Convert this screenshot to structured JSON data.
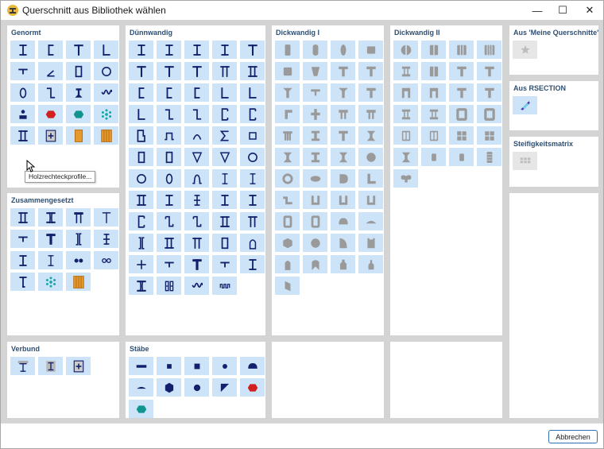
{
  "window": {
    "title": "Querschnitt aus Bibliothek wählen",
    "minimize_glyph": "—",
    "maximize_glyph": "☐",
    "close_glyph": "✕"
  },
  "colors": {
    "tile_fill": "#cde3f7",
    "shape_fill": "#14206b",
    "shape_gray": "#9a9a9a",
    "heading_text": "#2e4f73",
    "panel_bg": "#ffffff",
    "gutter": "#d4d4d4"
  },
  "panels": [
    {
      "id": "genormt",
      "title": "Genormt",
      "tiles": [
        "i-beam",
        "channel",
        "tee",
        "angle",
        "tee-flange",
        "angle-thin",
        "rect-hollow",
        "circle-hollow",
        "oval-hollow",
        "z-section",
        "rail",
        "wave",
        "rail-small",
        "hexagon-red",
        "hexagon-teal",
        "snowflake",
        "double-i",
        "boxed-plus",
        "timber-rect",
        "timber-multi"
      ]
    },
    {
      "id": "zusammengesetzt",
      "title": "Zusammengesetzt",
      "tiles": [
        "double-i",
        "double-channel",
        "tee-box",
        "tee-thin",
        "tee-flange",
        "tee-bold",
        "bar-channels",
        "cross-beam",
        "i-beam",
        "i-beam-thin",
        "dots-filled",
        "dots-hollow",
        "tee-offset",
        "snowflake",
        "timber-multi"
      ]
    },
    {
      "id": "verbund",
      "title": "Verbund",
      "tiles": [
        "composite-tee",
        "composite-i",
        "boxed-plus"
      ]
    },
    {
      "id": "duennwandig",
      "title": "Dünnwandig",
      "tiles": [
        "i-beam",
        "i-beam",
        "i-beam",
        "i-beam",
        "tee",
        "tee",
        "tee",
        "tee",
        "pi",
        "double-i",
        "channel",
        "channel",
        "channel",
        "angle",
        "angle",
        "angle",
        "z-section",
        "z-section",
        "channel-lip",
        "channel-lip",
        "b-shape",
        "hat",
        "arc",
        "sigma",
        "square-hollow",
        "rect-hollow",
        "rect-hollow",
        "triangle-hollow",
        "triangle-hollow",
        "circle-hollow",
        "circle-hollow",
        "oval-hollow",
        "omega",
        "i-beam-thin",
        "i-beam-thin",
        "double-i",
        "i-beam",
        "cross-beam",
        "i-beam",
        "i-beam",
        "channel-lip",
        "z-lip",
        "z-lip",
        "double-i",
        "pi",
        "bar-channels",
        "double-i",
        "pi",
        "rect-hollow",
        "arch",
        "plus",
        "tee-flange",
        "tee-bold",
        "tee-flange",
        "i-beam",
        "double-channel",
        "double-b",
        "wave",
        "wave-small"
      ]
    },
    {
      "id": "staebe",
      "title": "Stäbe",
      "tiles": [
        "bar-flat",
        "square-small",
        "square",
        "dot",
        "half-circle",
        "arc-flat",
        "hexagon",
        "dot-large",
        "triangle",
        "hexagon-red",
        "hexagon-teal"
      ]
    },
    {
      "id": "dickwandig-i",
      "title": "Dickwandig I",
      "tiles": [
        "g-rect-tall",
        "g-rounded",
        "g-oval-tall",
        "g-rect",
        "g-square",
        "g-trapezoid",
        "g-tee",
        "g-tee",
        "g-tee-slope",
        "g-tee-flat",
        "g-tee-slope",
        "g-tee",
        "g-angle",
        "g-plus",
        "g-pi",
        "g-pi",
        "g-pi-dbl",
        "g-i",
        "g-tee",
        "g-i-cut",
        "g-i-cut",
        "g-i",
        "g-i-cut",
        "g-circle",
        "g-circle-ring",
        "g-oval",
        "g-d-shape",
        "g-angle-l",
        "g-z",
        "g-u",
        "g-u",
        "g-u",
        "g-rect-ring",
        "g-rect-ring",
        "g-half-circle",
        "g-half-flat",
        "g-hexagon",
        "g-circle",
        "g-quarter",
        "g-notched",
        "g-bullet",
        "g-arch",
        "g-bottle",
        "g-bottle-small",
        "g-wedge"
      ]
    },
    {
      "id": "dickwandig-ii",
      "title": "Dickwandig II",
      "tiles": [
        "g-circle-split",
        "g-rect-split",
        "g-rect-split3",
        "g-rect-split4",
        "g-i-box",
        "g-rect-split",
        "g-tee",
        "g-tee",
        "g-arch-square",
        "g-arch-square",
        "g-tee",
        "g-tee",
        "g-i-box",
        "g-i-box",
        "g-square-ring",
        "g-square-ring",
        "g-rect-grid",
        "g-rect-grid",
        "g-grid4",
        "g-grid4",
        "g-i-cut",
        "g-rect-small",
        "g-rect-small",
        "g-rect-ridge",
        "g-wave-tee"
      ]
    },
    {
      "id": "meine",
      "title": "Aus 'Meine Querschnitte'",
      "tiles": [
        "star"
      ]
    },
    {
      "id": "rsection",
      "title": "Aus RSECTION",
      "tiles": [
        "rsection-logo"
      ]
    },
    {
      "id": "steifigkeit",
      "title": "Steifigkeitsmatrix",
      "tiles": [
        "matrix-grid"
      ]
    }
  ],
  "tooltip": {
    "text": "Holzrechteckprofile..."
  },
  "footer": {
    "cancel_label": "Abbrechen"
  }
}
